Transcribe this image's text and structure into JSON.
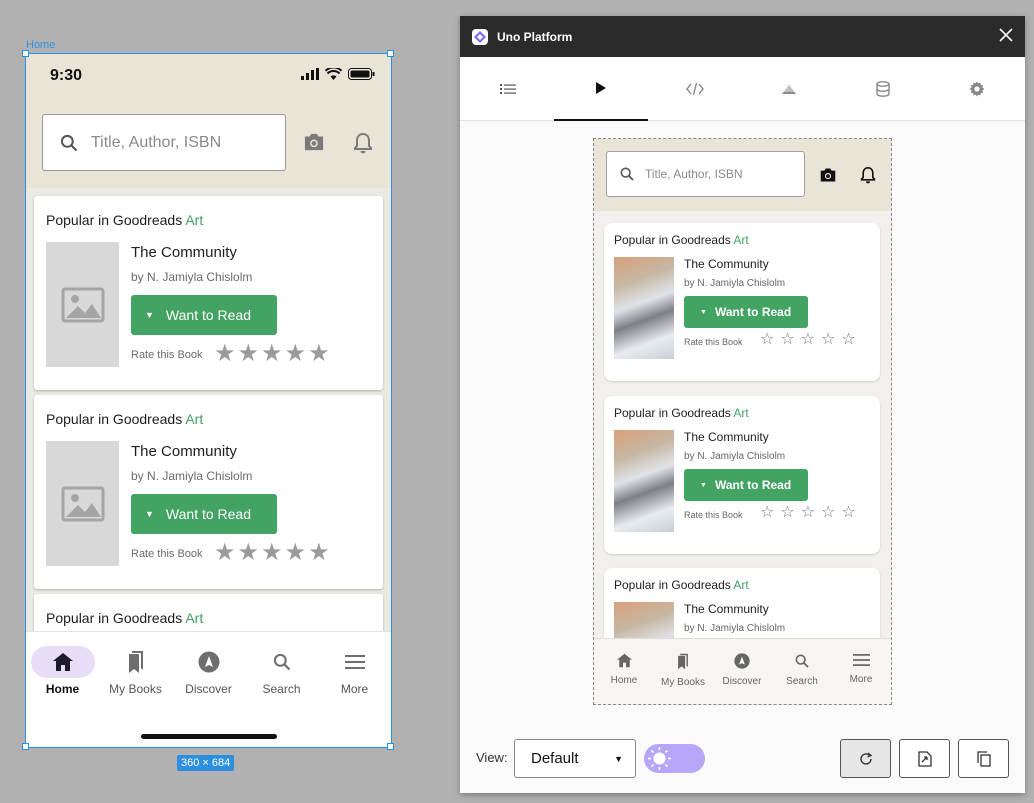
{
  "canvas": {
    "frame_label": "Home",
    "size_badge": "360 × 684"
  },
  "phone": {
    "time": "9:30",
    "search_placeholder": "Title, Author, ISBN",
    "cards": [
      {
        "title_prefix": "Popular in Goodreads ",
        "title_accent": "Art",
        "book": "The Community",
        "author": "by N. Jamiyla Chislolm",
        "button": "Want to Read",
        "rate_label": "Rate this Book"
      },
      {
        "title_prefix": "Popular in Goodreads ",
        "title_accent": "Art",
        "book": "The Community",
        "author": "by N. Jamiyla Chislolm",
        "button": "Want to Read",
        "rate_label": "Rate this Book"
      },
      {
        "title_prefix": "Popular in Goodreads ",
        "title_accent": "Art"
      }
    ],
    "nav": [
      {
        "label": "Home",
        "icon": "home-icon",
        "active": true
      },
      {
        "label": "My Books",
        "icon": "bookmarks-icon"
      },
      {
        "label": "Discover",
        "icon": "compass-icon"
      },
      {
        "label": "Search",
        "icon": "search-icon"
      },
      {
        "label": "More",
        "icon": "menu-icon"
      }
    ]
  },
  "uno": {
    "title": "Uno Platform",
    "tabs": [
      "list-icon",
      "play-icon",
      "code-icon",
      "layers-icon",
      "database-icon",
      "settings-icon"
    ],
    "active_tab": 1,
    "preview": {
      "search_placeholder": "Title, Author, ISBN",
      "cards": [
        {
          "title_prefix": "Popular in Goodreads ",
          "title_accent": "Art",
          "book": "The Community",
          "author": "by N. Jamiyla Chislolm",
          "button": "Want to Read",
          "rate_label": "Rate this Book"
        },
        {
          "title_prefix": "Popular in Goodreads ",
          "title_accent": "Art",
          "book": "The Community",
          "author": "by N. Jamiyla Chislolm",
          "button": "Want to Read",
          "rate_label": "Rate this Book"
        },
        {
          "title_prefix": "Popular in Goodreads ",
          "title_accent": "Art",
          "book": "The Community",
          "author": "by N. Jamiyla Chislolm"
        }
      ],
      "nav": [
        "Home",
        "My Books",
        "Discover",
        "Search",
        "More"
      ]
    },
    "footer": {
      "view_label": "View:",
      "view_value": "Default"
    }
  },
  "colors": {
    "accent_green": "#43a363",
    "selection_blue": "#2d8fe0",
    "toggle_purple": "#b7a5f8",
    "header_beige": "#e8e4d6"
  }
}
